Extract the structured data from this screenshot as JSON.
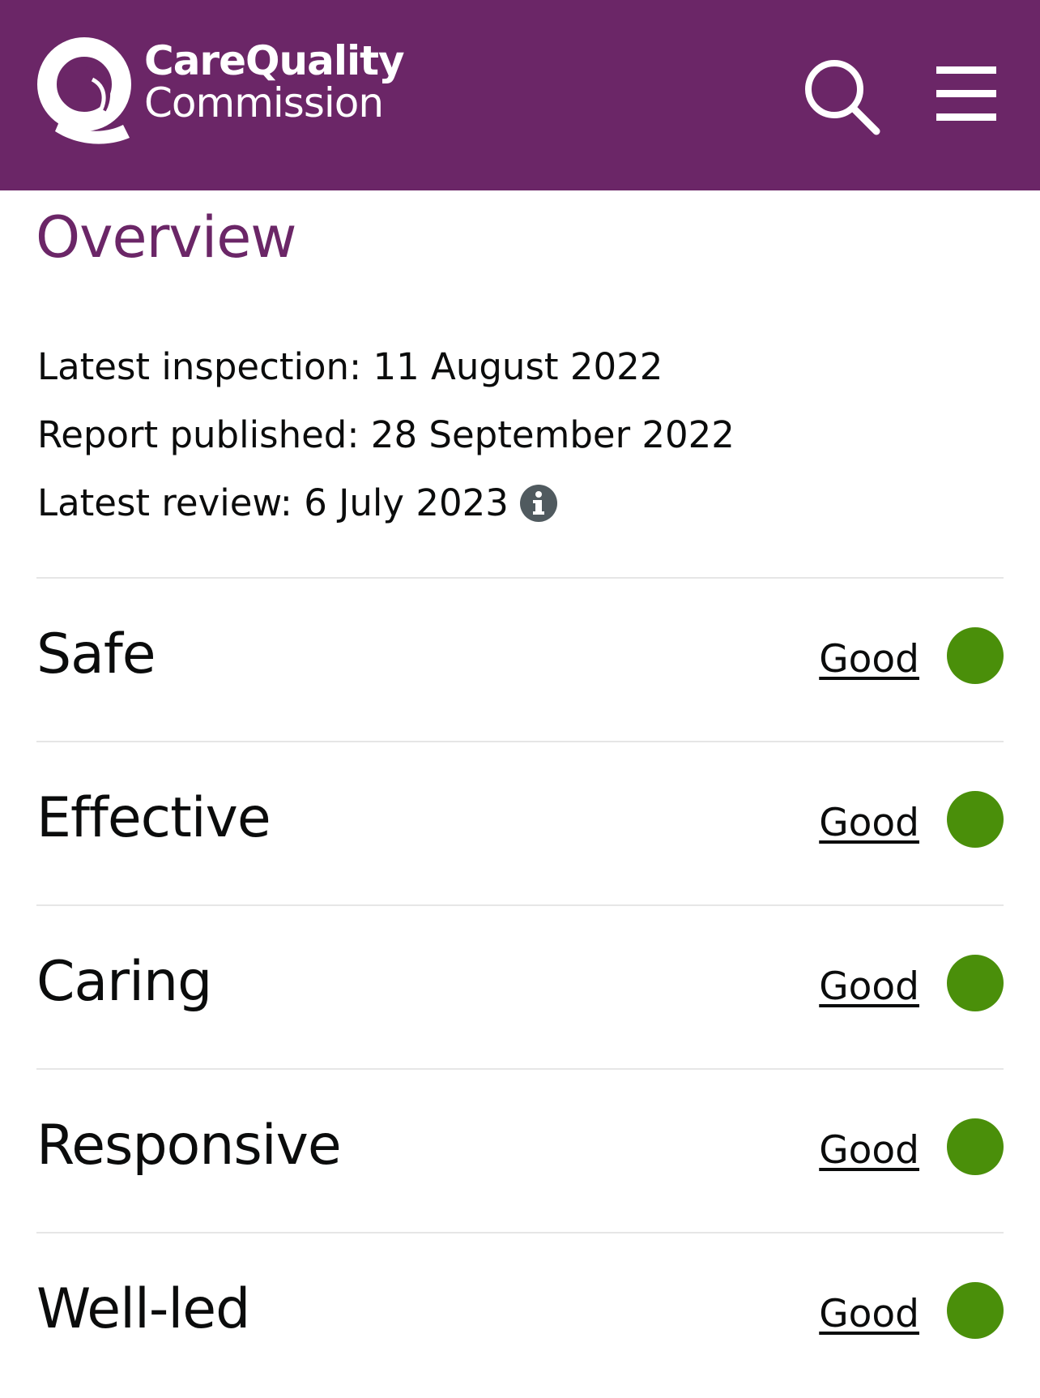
{
  "header": {
    "logo_line1": "CareQuality",
    "logo_line2": "Commission",
    "background_color": "#6b2667",
    "search_icon": "search-icon",
    "menu_icon": "hamburger-menu-icon"
  },
  "overview": {
    "title": "Overview",
    "latest_inspection": "Latest inspection: 11 August 2022",
    "report_published": "Report published: 28 September 2022",
    "latest_review": "Latest review: 6 July 2023",
    "info_icon": "info-icon"
  },
  "ratings": [
    {
      "label": "Safe",
      "rating": "Good",
      "color": "#4a8f0a"
    },
    {
      "label": "Effective",
      "rating": "Good",
      "color": "#4a8f0a"
    },
    {
      "label": "Caring",
      "rating": "Good",
      "color": "#4a8f0a"
    },
    {
      "label": "Responsive",
      "rating": "Good",
      "color": "#4a8f0a"
    },
    {
      "label": "Well-led",
      "rating": "Good",
      "color": "#4a8f0a"
    }
  ]
}
